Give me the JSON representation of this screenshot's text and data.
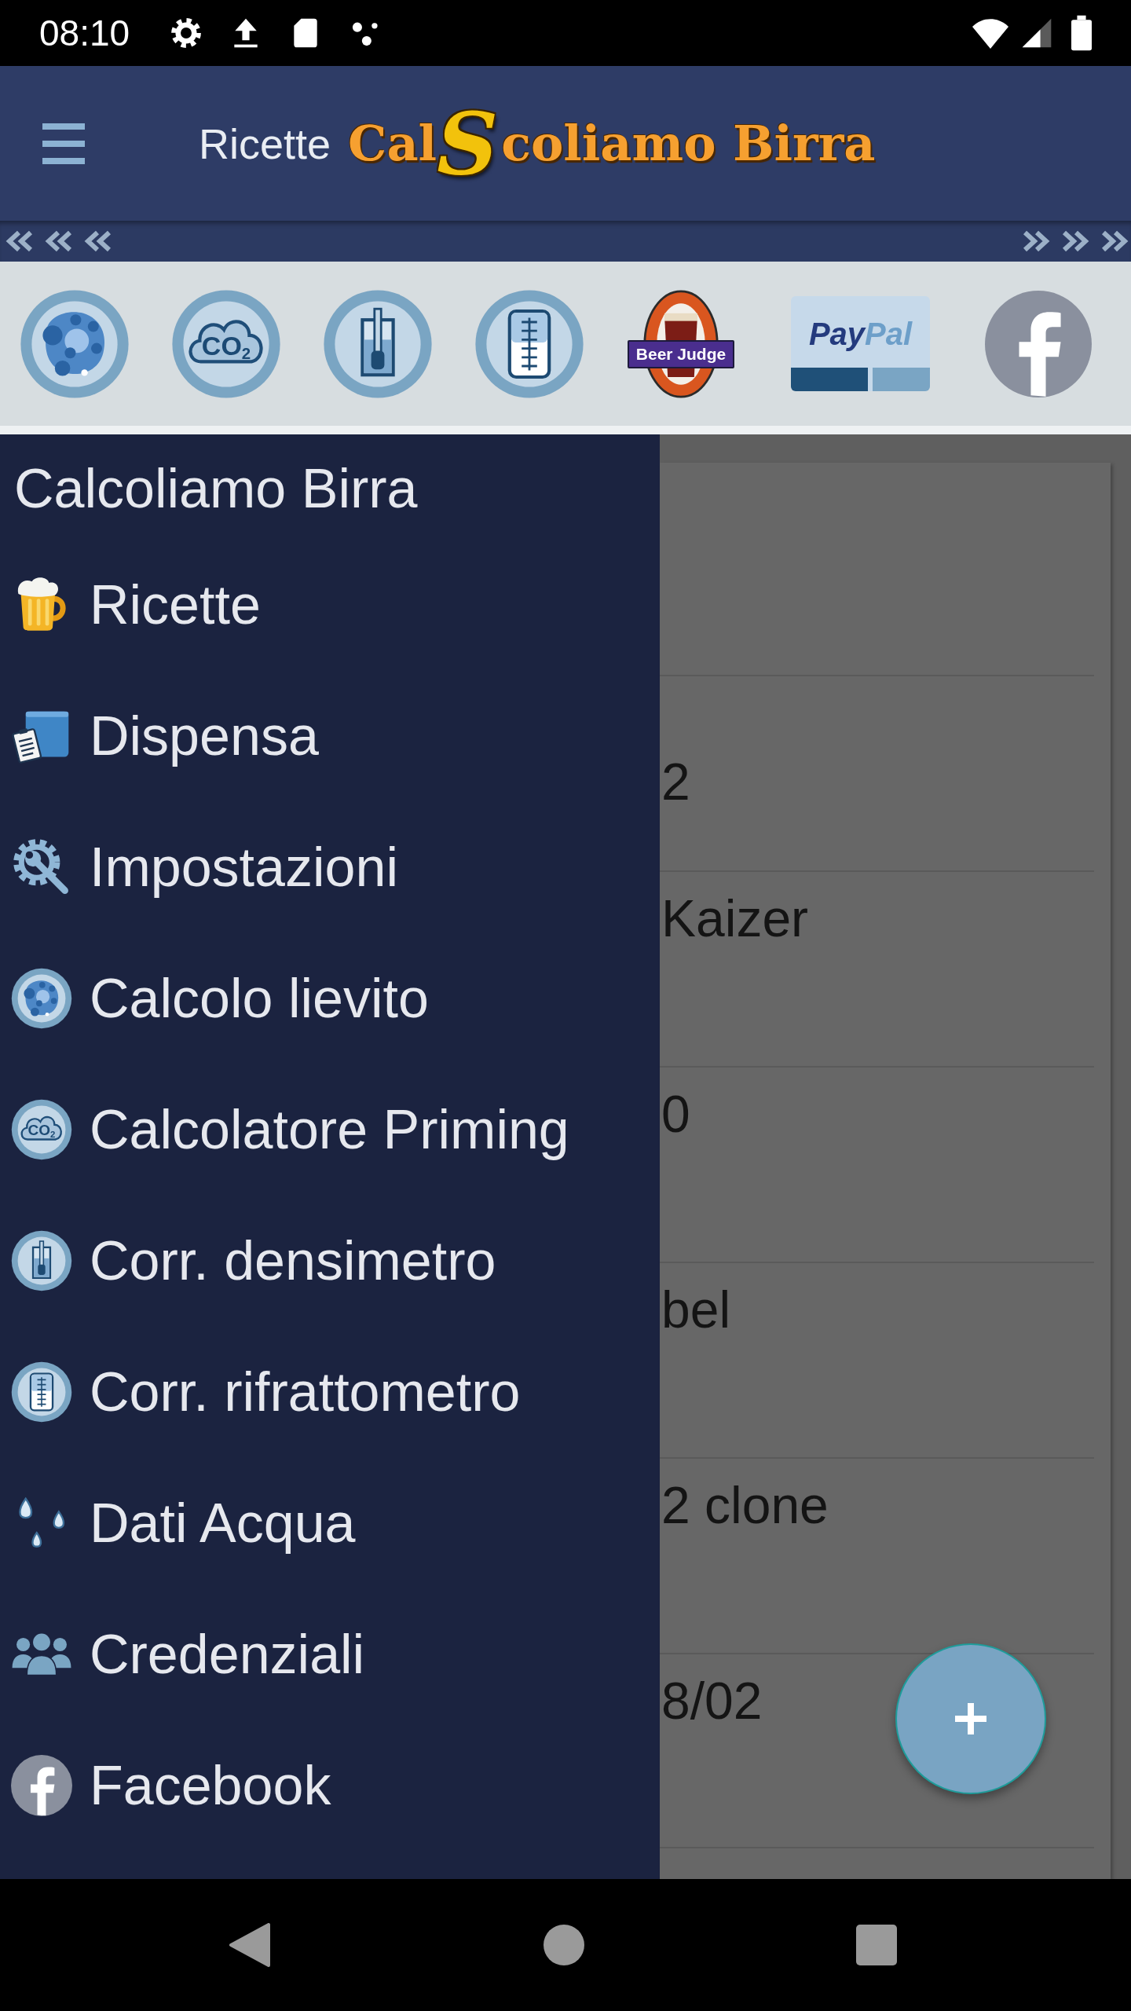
{
  "status_bar": {
    "time": "08:10"
  },
  "app_bar": {
    "title": "Ricette",
    "logo": {
      "before": "Cal",
      "emblem": "S",
      "after": "coliamo Birra"
    }
  },
  "shortcuts": [
    {
      "kind": "yeast"
    },
    {
      "kind": "co2",
      "icon_text": "CO$_{2}$"
    },
    {
      "kind": "hydrometer"
    },
    {
      "kind": "refractometer"
    },
    {
      "kind": "badge",
      "label": "Beer Judge"
    },
    {
      "kind": "paypal",
      "label_dark": "Pay",
      "label_light": "Pal"
    },
    {
      "kind": "facebook"
    }
  ],
  "drawer": {
    "title": "Calcoliamo Birra",
    "items": [
      {
        "label": "Ricette",
        "kind": "beer",
        "selected": false
      },
      {
        "label": "Dispensa",
        "kind": "pantry",
        "selected": false
      },
      {
        "label": "Impostazioni",
        "kind": "settings",
        "selected": false
      },
      {
        "label": "Calcolo lievito",
        "kind": "yeast",
        "selected": false
      },
      {
        "label": "Calcolatore Priming",
        "kind": "co2",
        "icon_text": "CO$_{2}$",
        "selected": false
      },
      {
        "label": "Corr. densimetro",
        "kind": "hydrometer",
        "selected": false
      },
      {
        "label": "Corr. rifrattometro",
        "kind": "refractometer",
        "selected": false
      },
      {
        "label": "Dati Acqua",
        "kind": "water",
        "selected": false
      },
      {
        "label": "Credenziali",
        "kind": "people",
        "selected": false
      },
      {
        "label": "Facebook",
        "kind": "facebook",
        "selected": false
      }
    ]
  },
  "recipe_list": {
    "rows": [
      {
        "second_line": "2"
      },
      {
        "title": "Kaizer"
      },
      {
        "title": "0"
      },
      {
        "title": "bel"
      },
      {
        "title": "2 clone"
      },
      {
        "title": "8/02"
      }
    ]
  }
}
